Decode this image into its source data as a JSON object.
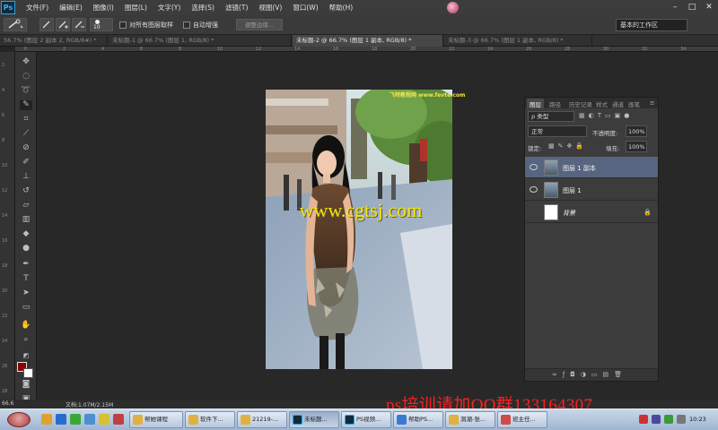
{
  "menubar": {
    "logo": "Ps",
    "items": [
      "文件(F)",
      "编辑(E)",
      "图像(I)",
      "图层(L)",
      "文字(Y)",
      "选择(S)",
      "滤镜(T)",
      "视图(V)",
      "窗口(W)",
      "帮助(H)"
    ],
    "window_controls": [
      "–",
      "□",
      "✕"
    ]
  },
  "options": {
    "brush_size": "10",
    "sample_all_layers_label": "对所有图层取样",
    "auto_enhance_label": "自动增强",
    "refine_edge_label": "调整边缘...",
    "workspace_label": "基本的工作区"
  },
  "tabs": [
    {
      "label": "56.7% (图层 2 副本 2, RGB/8#) *"
    },
    {
      "label": "未标题-1 @ 66.7% (图层 1, RGB/8) *"
    },
    {
      "label": "未标题-2 @ 66.7% (图层 1 副本, RGB/8) *"
    },
    {
      "label": "未标题-3 @ 66.7% (图层 1 副本, RGB/8) *"
    }
  ],
  "rulers": {
    "top": [
      "0",
      "2",
      "4",
      "6",
      "8",
      "10",
      "12",
      "14",
      "16",
      "18",
      "20",
      "22",
      "24",
      "26",
      "28",
      "30",
      "32",
      "34"
    ],
    "left": [
      "2",
      "4",
      "6",
      "8",
      "10",
      "12",
      "14",
      "16",
      "18",
      "20",
      "22",
      "24",
      "26",
      "28"
    ]
  },
  "canvas": {
    "watermark_top": "飞特教程网 www.fevte.com",
    "watermark_url": "www.cgtsj.com"
  },
  "layers_panel": {
    "tabs": [
      "图层",
      "路径",
      "历史记录",
      "样式",
      "通道",
      "画笔"
    ],
    "filter_label": "ρ 类型",
    "blend_mode": "正常",
    "opacity_label": "不透明度:",
    "opacity_value": "100%",
    "lock_label": "锁定:",
    "fill_label": "填充:",
    "fill_value": "100%",
    "layers": [
      {
        "name": "图层 1 副本",
        "selected": true
      },
      {
        "name": "图层 1",
        "selected": false
      },
      {
        "name": "背景",
        "selected": false
      }
    ]
  },
  "status": {
    "zoom": "66.6",
    "doc_info": "文档:1.07M/2.15M"
  },
  "qq_watermark": "ps培训请加QQ群133164307",
  "taskbar": {
    "buttons": [
      "帮她课程",
      "软件下...",
      "21219-...",
      "未标题...",
      "PS视频...",
      "帮助PS...",
      "洞潮-张...",
      "班主任..."
    ],
    "clock": "10:23"
  },
  "colors": {
    "foreground": "#8b0000",
    "background": "#ffffff",
    "selected_layer": "#586580",
    "watermark_yellow": "#f7e600",
    "qq_red": "#ff1f1f"
  }
}
